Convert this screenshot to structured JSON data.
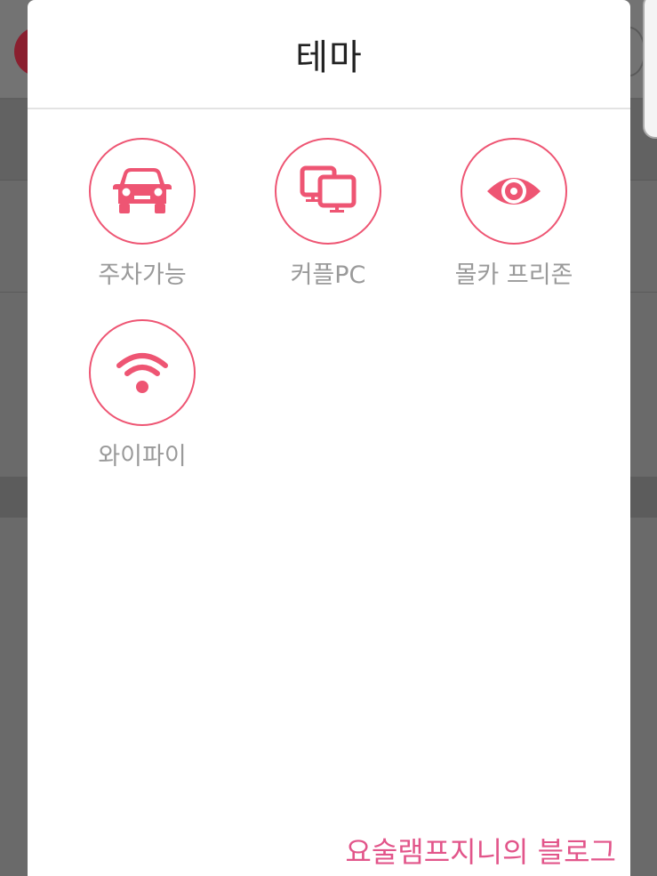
{
  "modal": {
    "title": "테마"
  },
  "themes": [
    {
      "label": "주차가능",
      "icon": "car-icon"
    },
    {
      "label": "커플PC",
      "icon": "monitors-icon"
    },
    {
      "label": "몰카 프리존",
      "icon": "eye-icon"
    },
    {
      "label": "와이파이",
      "icon": "wifi-icon"
    }
  ],
  "watermark": "요술램프지니의 블로그",
  "colors": {
    "accent": "#ee5573",
    "label": "#9a9a9a",
    "title": "#222222",
    "overlay": "#666666",
    "watermark": "#e2558a"
  }
}
